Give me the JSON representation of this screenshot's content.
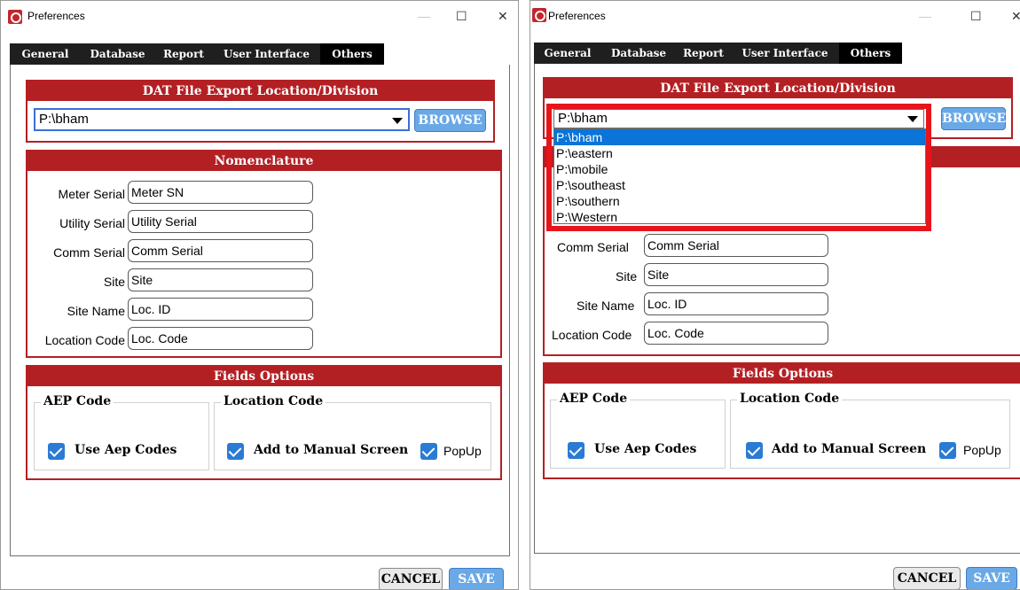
{
  "window": {
    "title": "Preferences",
    "minimize": "—",
    "maximize": "☐",
    "close": "✕"
  },
  "tabs": [
    "General",
    "Database",
    "Report",
    "User Interface",
    "Others"
  ],
  "active_tab": "Others",
  "export_section": {
    "title": "DAT File Export Location/Division",
    "selected_path": "P:\\bham",
    "browse_label": "BROWSE",
    "options": [
      "P:\\bham",
      "P:\\eastern",
      "P:\\mobile",
      "P:\\southeast",
      "P:\\southern",
      "P:\\Western"
    ]
  },
  "nomenclature": {
    "title": "Nomenclature",
    "fields": [
      {
        "label": "Meter Serial",
        "value": "Meter SN"
      },
      {
        "label": "Utility Serial",
        "value": "Utility Serial"
      },
      {
        "label": "Comm Serial",
        "value": "Comm Serial"
      },
      {
        "label": "Site",
        "value": "Site"
      },
      {
        "label": "Site Name",
        "value": "Loc. ID"
      },
      {
        "label": "Location Code",
        "value": "Loc. Code"
      }
    ]
  },
  "fields_options": {
    "title": "Fields Options",
    "aep_group": {
      "title": "AEP Code",
      "checkbox_label": "Use Aep Codes",
      "checked": true
    },
    "location_group": {
      "title": "Location Code",
      "add_manual_label": "Add to Manual Screen",
      "add_manual_checked": true,
      "popup_label": "PopUp",
      "popup_checked": true
    }
  },
  "footer": {
    "cancel_label": "CANCEL",
    "save_label": "SAVE"
  },
  "colors": {
    "section_red": "#b32024",
    "accent_blue": "#6aa9e6",
    "highlight_red": "#e8141b",
    "selected_item": "#0a74d8"
  }
}
